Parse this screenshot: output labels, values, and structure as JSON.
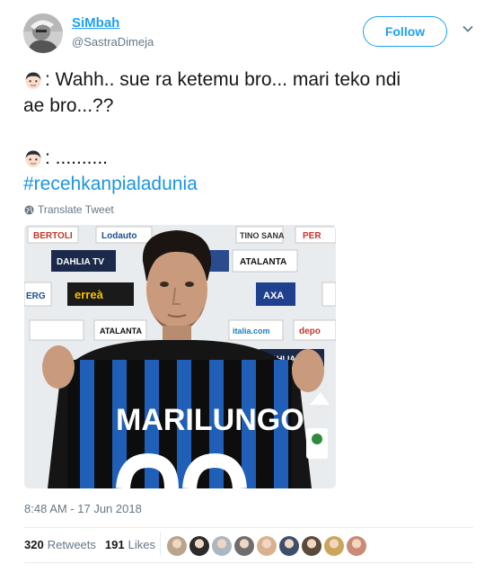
{
  "author": {
    "display_name": "SiMbah",
    "handle": "@SastraDimeja",
    "avatar_icon": "user-avatar-photo"
  },
  "follow_label": "Follow",
  "tweet": {
    "line1": ": Wahh.. sue ra ketemu bro... mari teko ndi",
    "line2": "ae bro...??",
    "line3": ": ..........",
    "hashtag": "#recehkanpialadunia",
    "emoji_icon": "boy-face-emoji"
  },
  "translate_label": "Translate Tweet",
  "media": {
    "jersey_text": "MARILUNGO",
    "sponsor_texts": [
      "BERTOLI",
      "Lodauto",
      "TINO SANA",
      "PER",
      "DAHLIA TV",
      "ATALANTA",
      "ERG",
      "erreà",
      "AXA",
      "ATALANTA",
      "italia.com",
      "depo",
      "DAHLIA TV"
    ]
  },
  "timestamp": "8:48 AM - 17 Jun 2018",
  "stats": {
    "retweets_count": "320",
    "retweets_label": "Retweets",
    "likes_count": "191",
    "likes_label": "Likes"
  },
  "liker_colors": [
    "#b9a48c",
    "#2b2b2b",
    "#aab8c2",
    "#6e6e6e",
    "#d8b28f",
    "#3d4f6b",
    "#5a4a3a",
    "#c9a65a",
    "#c78b76"
  ],
  "accent_color": "#1da1f2"
}
